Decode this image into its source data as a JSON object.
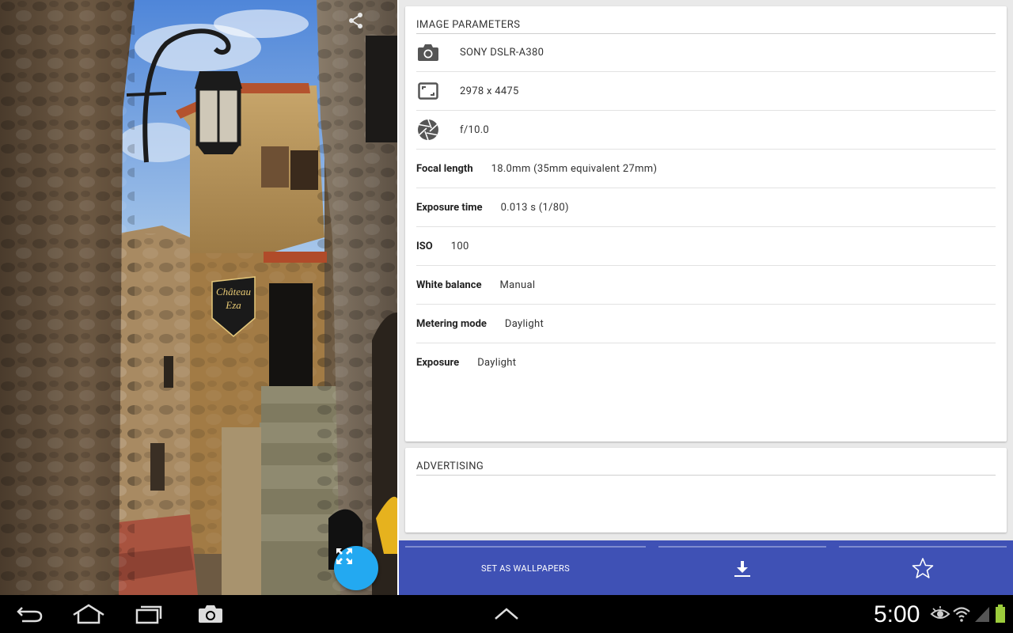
{
  "photo": {
    "sign_line1": "Château",
    "sign_line2": "Eza"
  },
  "params": {
    "header": "IMAGE PARAMETERS",
    "camera": {
      "icon": "camera-icon",
      "value": "SONY  DSLR-A380"
    },
    "resolution": {
      "icon": "aspect-ratio-icon",
      "value": "2978 x 4475"
    },
    "aperture": {
      "icon": "aperture-icon",
      "value": "f/10.0"
    },
    "focal_length": {
      "label": "Focal length",
      "value": "18.0mm (35mm equivalent 27mm)"
    },
    "exposure_time": {
      "label": "Exposure time",
      "value": "0.013 s (1/80)"
    },
    "iso": {
      "label": "ISO",
      "value": "100"
    },
    "white_balance": {
      "label": "White balance",
      "value": "Manual"
    },
    "metering_mode": {
      "label": "Metering mode",
      "value": "Daylight"
    },
    "exposure": {
      "label": "Exposure",
      "value": "Daylight"
    }
  },
  "ad": {
    "header": "ADVERTISING"
  },
  "actions": {
    "wallpaper_label": "SET AS WALLPAPERS",
    "download_icon": "download-icon",
    "favorite_icon": "star-outline-icon"
  },
  "system": {
    "clock": "5:00",
    "nav_icons": [
      "back-icon",
      "home-icon",
      "recent-apps-icon",
      "screenshot-icon",
      "chevron-up-icon"
    ],
    "status_icons": [
      "eye-icon",
      "wifi-icon",
      "signal-icon",
      "battery-icon"
    ]
  },
  "colors": {
    "action_bar": "#3f51b5",
    "fab": "#23a9f1",
    "battery": "#9ccc3c"
  }
}
